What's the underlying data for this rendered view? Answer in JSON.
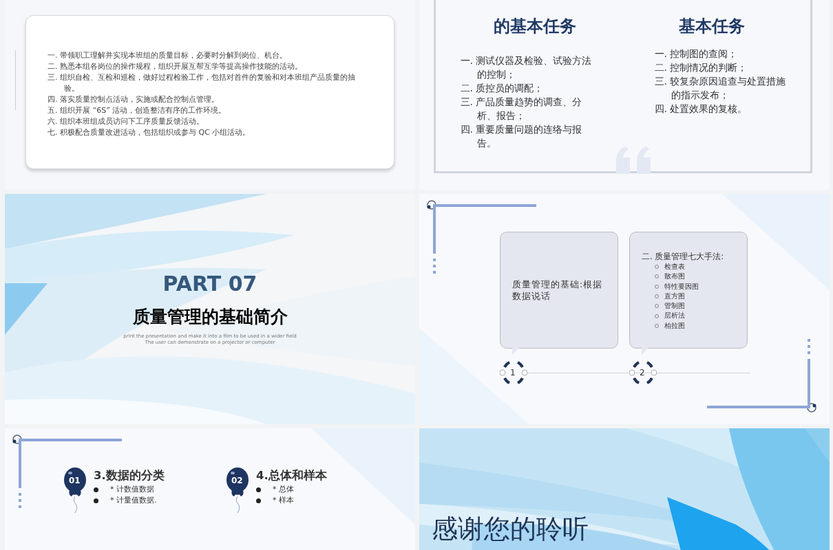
{
  "slides": [
    {
      "kind": "card_list",
      "items": [
        "一. 带领职工理解并实现本班组的质量目标，必要时分解到岗位、机台。",
        "二. 熟悉本组各岗位的操作规程，组织开展互帮互学等提高操作技能的活动。",
        "三. 组织自检、互检和巡检，做好过程检验工作，包括对首件的复验和对本班组产品质量的抽验。",
        "四. 落实质量控制点活动，实施或配合控制点管理。",
        "五. 组织开展 “6S” 活动，创造整洁有序的工作环境。",
        "六. 组织本班组成员访问下工序质量反馈活动。",
        "七. 积极配合质量改进活动，包括组织或参与 QC 小组活动。"
      ]
    },
    {
      "kind": "two_columns",
      "columns": [
        {
          "title": "的基本任务",
          "items": [
            "一. 测试仪器及检验、试验方法的控制；",
            "二. 质控员的调配；",
            "三. 产品质量趋势的调查、分析、报告；",
            "四. 重要质量问题的连络与报告。"
          ]
        },
        {
          "title": "基本任务",
          "items": [
            "一. 控制图的查阅；",
            "二. 控制情况的判断；",
            "三. 较复杂原因追查与处置措施的指示发布；",
            "四. 处置效果的复核。"
          ]
        }
      ]
    },
    {
      "kind": "section",
      "part": "PART 07",
      "title": "质量管理的基础简介",
      "subtitle": "print the presentation and make it into a film to be used in a wider field The user can demonstrate on a projector or computer"
    },
    {
      "kind": "callouts",
      "callouts": [
        {
          "number": "1",
          "text": "质量管理的基础:根据数据说话"
        },
        {
          "number": "2",
          "heading": "二. 质量管理七大手法:",
          "items": [
            "检查表",
            "散布图",
            "特性要因图",
            "直方图",
            "管制图",
            "层析法",
            "柏拉图"
          ]
        }
      ]
    },
    {
      "kind": "balloons",
      "groups": [
        {
          "number": "01",
          "title": "3.数据的分类",
          "items": [
            "* 计数值数据",
            "* 计量值数据."
          ]
        },
        {
          "number": "02",
          "title": "4.总体和样本",
          "items": [
            "* 总体",
            "* 样本"
          ]
        }
      ]
    },
    {
      "kind": "closing",
      "title": "感谢您的聆听"
    }
  ]
}
